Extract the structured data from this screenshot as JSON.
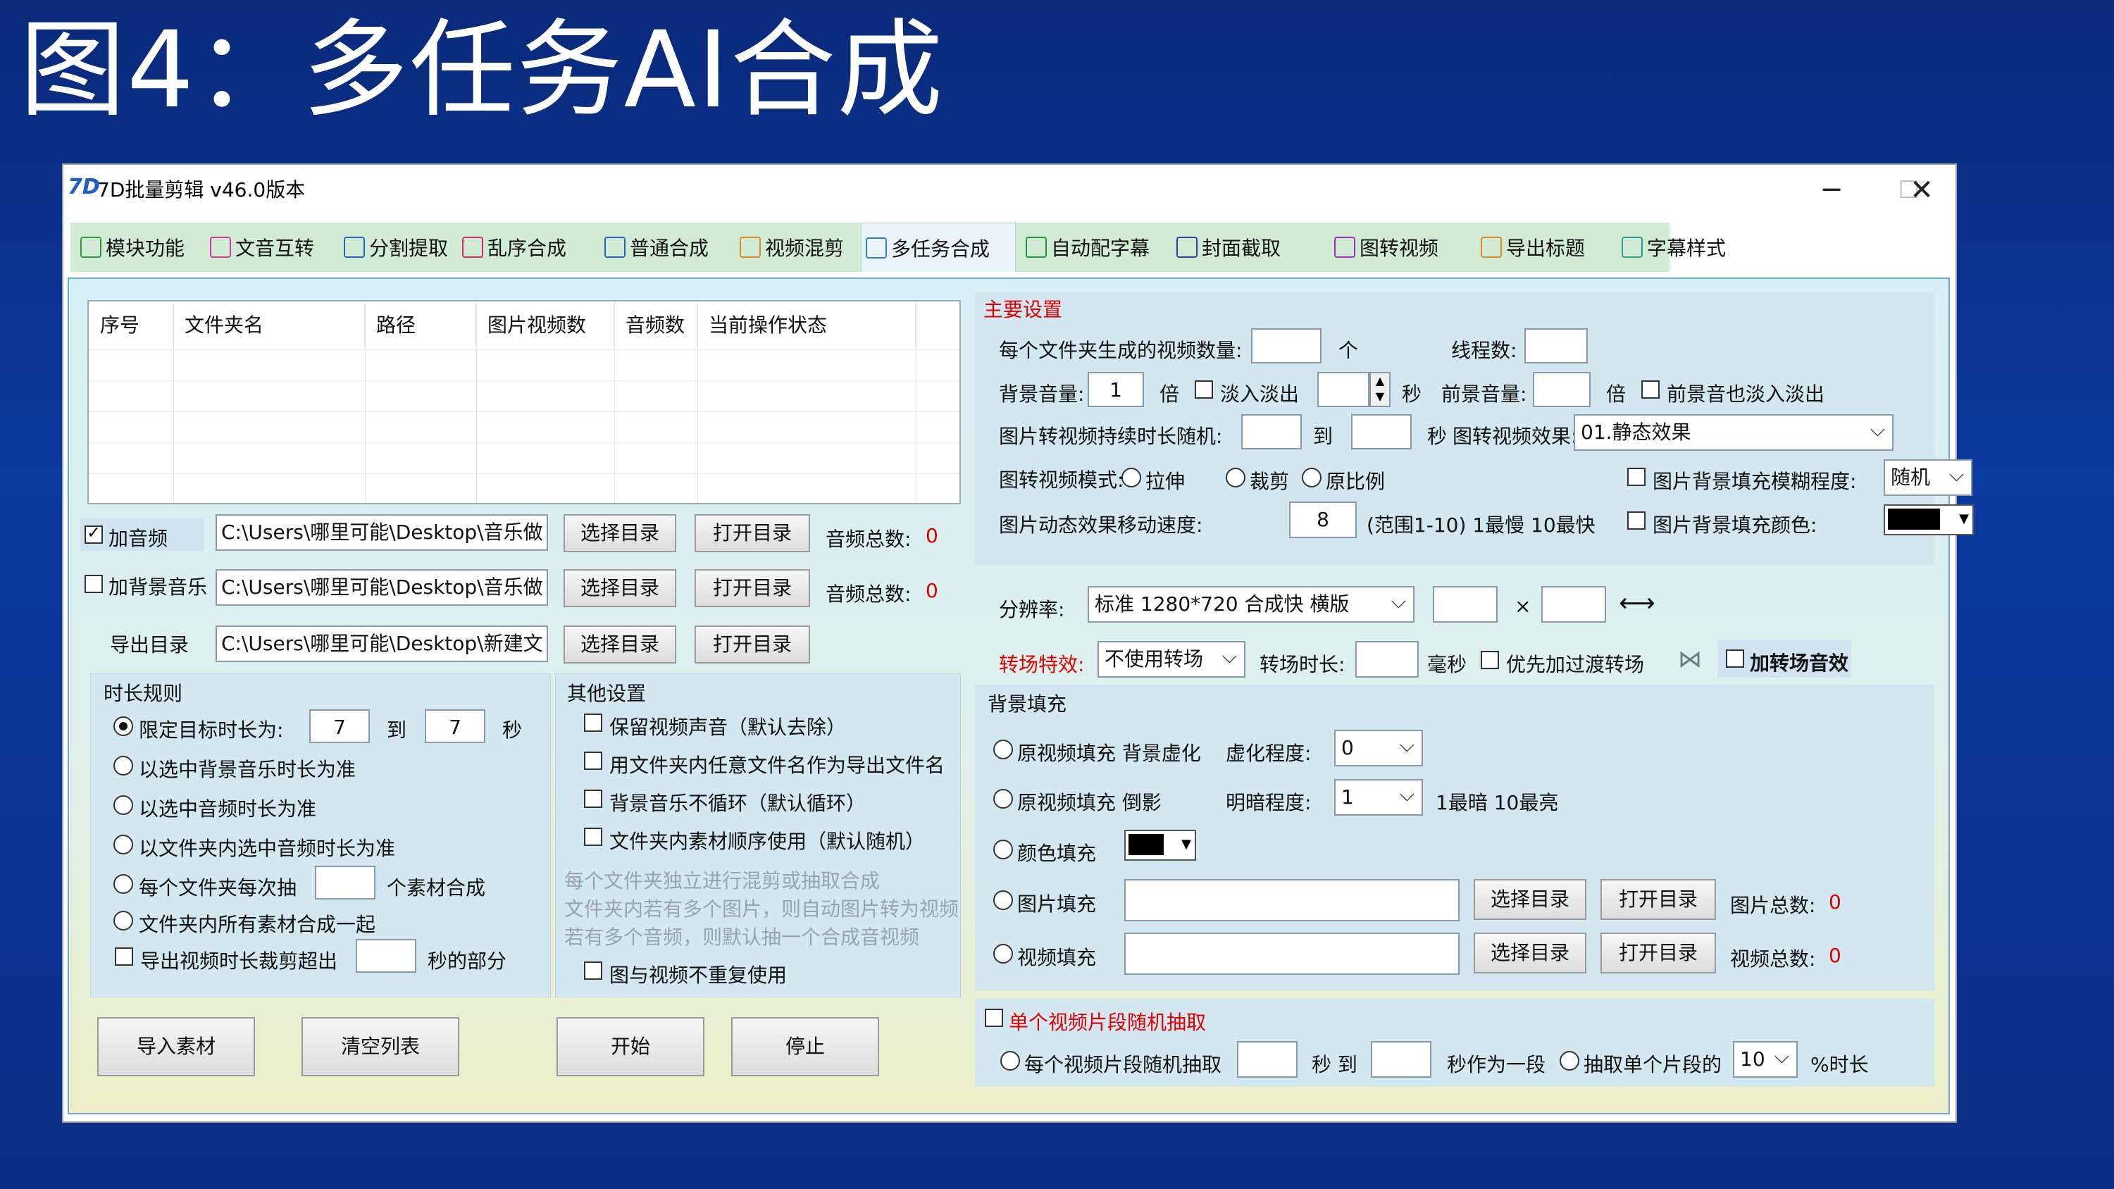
{
  "slide_title": "图4：多任务AI合成",
  "app": {
    "title": "7D批量剪辑 v46.0版本",
    "logo": "7D"
  },
  "window_controls": {
    "minimize": "─",
    "maximize": "☐",
    "close": "✕"
  },
  "tabs": [
    {
      "label": "模块功能",
      "icon": "modules-icon",
      "color": "#2e9e3a"
    },
    {
      "label": "文音互转",
      "icon": "text-audio-icon",
      "color": "#d23a9a"
    },
    {
      "label": "分割提取",
      "icon": "split-icon",
      "color": "#2a62c8"
    },
    {
      "label": "乱序合成",
      "icon": "shuffle-icon",
      "color": "#d02a6a"
    },
    {
      "label": "普通合成",
      "icon": "layers-icon",
      "color": "#2a62c8"
    },
    {
      "label": "视频混剪",
      "icon": "video-mix-icon",
      "color": "#e08a20"
    },
    {
      "label": "多任务合成",
      "icon": "multitask-icon",
      "color": "#2a86c8"
    },
    {
      "label": "自动配字幕",
      "icon": "chart-icon",
      "color": "#1e9a3a"
    },
    {
      "label": "封面截取",
      "icon": "cover-icon",
      "color": "#3a3aa8"
    },
    {
      "label": "图转视频",
      "icon": "image-video-icon",
      "color": "#a030c0"
    },
    {
      "label": "导出标题",
      "icon": "export-icon",
      "color": "#e08a20"
    },
    {
      "label": "字幕样式",
      "icon": "subtitle-icon",
      "color": "#2aa090"
    }
  ],
  "table": {
    "headers": [
      "序号",
      "文件夹名",
      "路径",
      "图片视频数",
      "音频数",
      "当前操作状态"
    ]
  },
  "audio": {
    "label": "加音频",
    "checked": true,
    "path": "C:\\Users\\哪里可能\\Desktop\\音乐做",
    "btn_select": "选择目录",
    "btn_open": "打开目录",
    "count_label": "音频总数:",
    "count": "0"
  },
  "bgmusic": {
    "label": "加背景音乐",
    "checked": false,
    "path": "C:\\Users\\哪里可能\\Desktop\\音乐做",
    "btn_select": "选择目录",
    "btn_open": "打开目录",
    "count_label": "音频总数:",
    "count": "0"
  },
  "export": {
    "label": "导出目录",
    "path": "C:\\Users\\哪里可能\\Desktop\\新建文",
    "btn_select": "选择目录",
    "btn_open": "打开目录"
  },
  "duration": {
    "title": "时长规则",
    "opt1": "限定目标时长为:",
    "from": "7",
    "to_label": "到",
    "to": "7",
    "unit": "秒",
    "opt2": "以选中背景音乐时长为准",
    "opt3": "以选中音频时长为准",
    "opt4": "以文件夹内选中音频时长为准",
    "opt5_a": "每个文件夹每次抽",
    "opt5_b": "个素材合成",
    "opt6": "文件夹内所有素材合成一起",
    "opt7_a": "导出视频时长裁剪超出",
    "opt7_b": "秒的部分"
  },
  "other": {
    "title": "其他设置",
    "c1": "保留视频声音（默认去除）",
    "c2": "用文件夹内任意文件名作为导出文件名",
    "c3": "背景音乐不循环（默认循环）",
    "c4": "文件夹内素材顺序使用（默认随机）",
    "hint1": "每个文件夹独立进行混剪或抽取合成",
    "hint2": "文件夹内若有多个图片，则自动图片转为视频",
    "hint3": "若有多个音频，则默认抽一个合成音视频",
    "c5": "图与视频不重复使用"
  },
  "buttons": {
    "import": "导入素材",
    "clear": "清空列表",
    "start": "开始",
    "stop": "停止"
  },
  "main": {
    "title": "主要设置",
    "videos_per_folder": "每个文件夹生成的视频数量:",
    "ge": "个",
    "threads": "线程数:",
    "bg_vol": "背景音量:",
    "bg_vol_val": "1",
    "bei": "倍",
    "fade": "淡入淡出",
    "sec": "秒",
    "fg_vol": "前景音量:",
    "fg_fade": "前景音也淡入淡出",
    "img_dur": "图片转视频持续时长随机:",
    "to": "到",
    "img_effect_label": "图转视频效果:",
    "img_effect": "01.静态效果",
    "img_mode": "图转视频模式:",
    "m1": "拉伸",
    "m2": "裁剪",
    "m3": "原比例",
    "blur_label": "图片背景填充模糊程度:",
    "blur": "随机",
    "speed_label": "图片动态效果移动速度:",
    "speed": "8",
    "speed_hint": "(范围1-10) 1最慢 10最快",
    "fill_color_label": "图片背景填充颜色:",
    "fill_color": "#000000"
  },
  "res": {
    "label": "分辨率:",
    "value": "标准 1280*720 合成快 横版",
    "x": "×",
    "swap_icon": "⟷"
  },
  "trans": {
    "label": "转场特效:",
    "value": "不使用转场",
    "dur_label": "转场时长:",
    "ms": "毫秒",
    "priority": "优先加过渡转场",
    "sound": "加转场音效"
  },
  "bgfill": {
    "title": "背景填充",
    "r1": "原视频填充 背景虚化",
    "blur_label": "虚化程度:",
    "blur": "0",
    "r2": "原视频填充 倒影",
    "dark_label": "明暗程度:",
    "dark": "1",
    "dark_hint": "1最暗 10最亮",
    "r3": "颜色填充",
    "color": "#000000",
    "r4": "图片填充",
    "r5": "视频填充",
    "btn_select": "选择目录",
    "btn_open": "打开目录",
    "img_count_label": "图片总数:",
    "img_count": "0",
    "vid_count_label": "视频总数:",
    "vid_count": "0"
  },
  "segment": {
    "title": "单个视频片段随机抽取",
    "r1": "每个视频片段随机抽取",
    "sec_to": "秒 到",
    "as_one": "秒作为一段",
    "r2": "抽取单个片段的",
    "pct": "10",
    "pct_label": "%时长"
  }
}
